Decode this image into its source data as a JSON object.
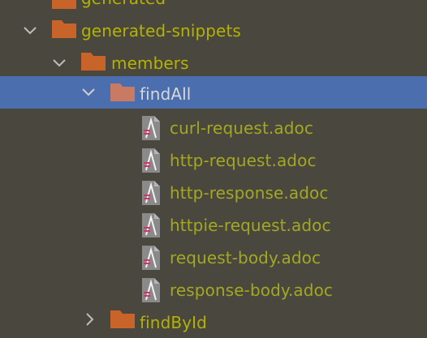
{
  "colors": {
    "background": "#4a473e",
    "selection": "#4b6eaf",
    "folder": "#c8642a",
    "folder_selected": "#c97a62",
    "modified_text": "#b3b300",
    "file_text": "#a3a823"
  },
  "tree": {
    "generated": {
      "label": "generated",
      "icon": "folder-icon"
    },
    "generated_snippets": {
      "label": "generated-snippets",
      "icon": "folder-icon",
      "expanded": true
    },
    "members": {
      "label": "members",
      "icon": "folder-icon",
      "expanded": true
    },
    "findAll": {
      "label": "findAll",
      "icon": "folder-icon",
      "expanded": true,
      "selected": true
    },
    "files": [
      {
        "label": "curl-request.adoc",
        "icon": "asciidoc-file-icon"
      },
      {
        "label": "http-request.adoc",
        "icon": "asciidoc-file-icon"
      },
      {
        "label": "http-response.adoc",
        "icon": "asciidoc-file-icon"
      },
      {
        "label": "httpie-request.adoc",
        "icon": "asciidoc-file-icon"
      },
      {
        "label": "request-body.adoc",
        "icon": "asciidoc-file-icon"
      },
      {
        "label": "response-body.adoc",
        "icon": "asciidoc-file-icon"
      }
    ],
    "findById": {
      "label": "findById",
      "icon": "folder-icon",
      "expanded": false
    }
  }
}
